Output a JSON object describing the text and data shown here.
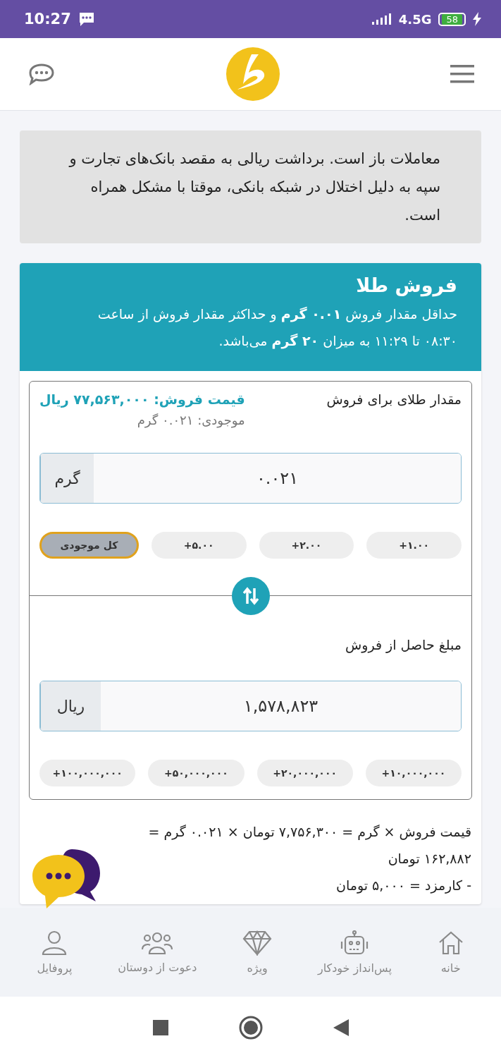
{
  "status_bar": {
    "time": "10:27",
    "network": "4.5G",
    "battery": "58"
  },
  "notice": {
    "text": "معاملات باز است. برداشت ریالی به مقصد بانک‌های تجارت و سپه به دلیل اختلال در شبکه بانکی، موقتا با مشکل همراه است."
  },
  "sell_card": {
    "title": "فروش طلا",
    "description": "حداقل مقدار فروش **۰.۰۱ گرم** و حداکثر مقدار فروش از ساعت ۰۸:۳۰ تا ۱۱:۲۹ به میزان **۲۰ گرم** می‌باشد.",
    "gold": {
      "label": "مقدار طلای برای فروش",
      "price": "قیمت فروش: ۷۷,۵۶۳,۰۰۰ ریال",
      "balance": "موجودی: ۰.۰۲۱ گرم",
      "value": "۰.۰۲۱",
      "unit": "گرم",
      "quick_buttons": [
        {
          "label": "+۱.۰۰",
          "selected": false
        },
        {
          "label": "+۲.۰۰",
          "selected": false
        },
        {
          "label": "+۵.۰۰",
          "selected": false
        },
        {
          "label": "کل موجودی",
          "selected": true
        }
      ]
    },
    "amount": {
      "label": "مبلغ حاصل از فروش",
      "value": "۱,۵۷۸,۸۲۳",
      "unit": "ریال",
      "quick_buttons": [
        {
          "label": "+۱۰,۰۰۰,۰۰۰",
          "selected": false
        },
        {
          "label": "+۲۰,۰۰۰,۰۰۰",
          "selected": false
        },
        {
          "label": "+۵۰,۰۰۰,۰۰۰",
          "selected": false
        },
        {
          "label": "+۱۰۰,۰۰۰,۰۰۰",
          "selected": false
        }
      ]
    },
    "formula": [
      "قیمت فروش × گرم = ۷,۷۵۶,۳۰۰ تومان × ۰.۰۲۱ گرم = ۱۶۲,۸۸۲ تومان",
      "- کارمزد = ۵,۰۰۰ تومان"
    ]
  },
  "bottom_nav": [
    {
      "label": "خانه"
    },
    {
      "label": "پس‌انداز خودکار"
    },
    {
      "label": "ویژه"
    },
    {
      "label": "دعوت از دوستان"
    },
    {
      "label": "پروفایل"
    }
  ]
}
